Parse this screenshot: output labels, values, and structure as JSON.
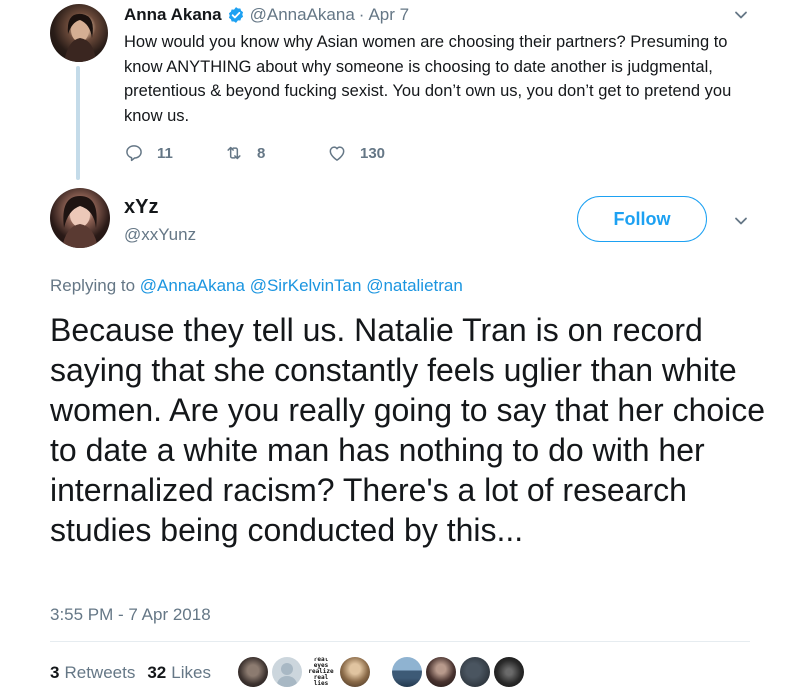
{
  "parent_tweet": {
    "name": "Anna Akana",
    "handle": "@AnnaAkana",
    "separator": "·",
    "time": "Apr 7",
    "text": "How would you know why Asian women are choosing their partners? Presuming to know ANYTHING about why someone is choosing to date another is judgmental, pretentious & beyond fucking sexist. You don’t own us, you don’t get to pretend you know us.",
    "replies": "11",
    "retweets": "8",
    "likes": "130",
    "verified_icon": "verified-badge-icon"
  },
  "main_tweet": {
    "name": "xYz",
    "handle": "@xxYunz",
    "follow_label": "Follow",
    "replying_prefix": "Replying to",
    "replying_to": [
      "@AnnaAkana",
      "@SirKelvinTan",
      "@natalietran"
    ],
    "text": "Because they tell us. Natalie Tran is on record saying that she constantly feels uglier than white women. Are you really going to say that her choice to date a white man has nothing to do with her internalized racism? There's a lot of research studies being conducted by this...",
    "timestamp": "3:55 PM - 7 Apr 2018",
    "retweet_count": "3",
    "retweet_label": "Retweets",
    "like_count": "32",
    "like_label": "Likes",
    "liker_badge_text": "real eyes realize real lies"
  },
  "colors": {
    "accent": "#1da1f2",
    "mention": "#1b95e0",
    "secondary_text": "#657786",
    "thread_line": "#c4dbe9"
  }
}
